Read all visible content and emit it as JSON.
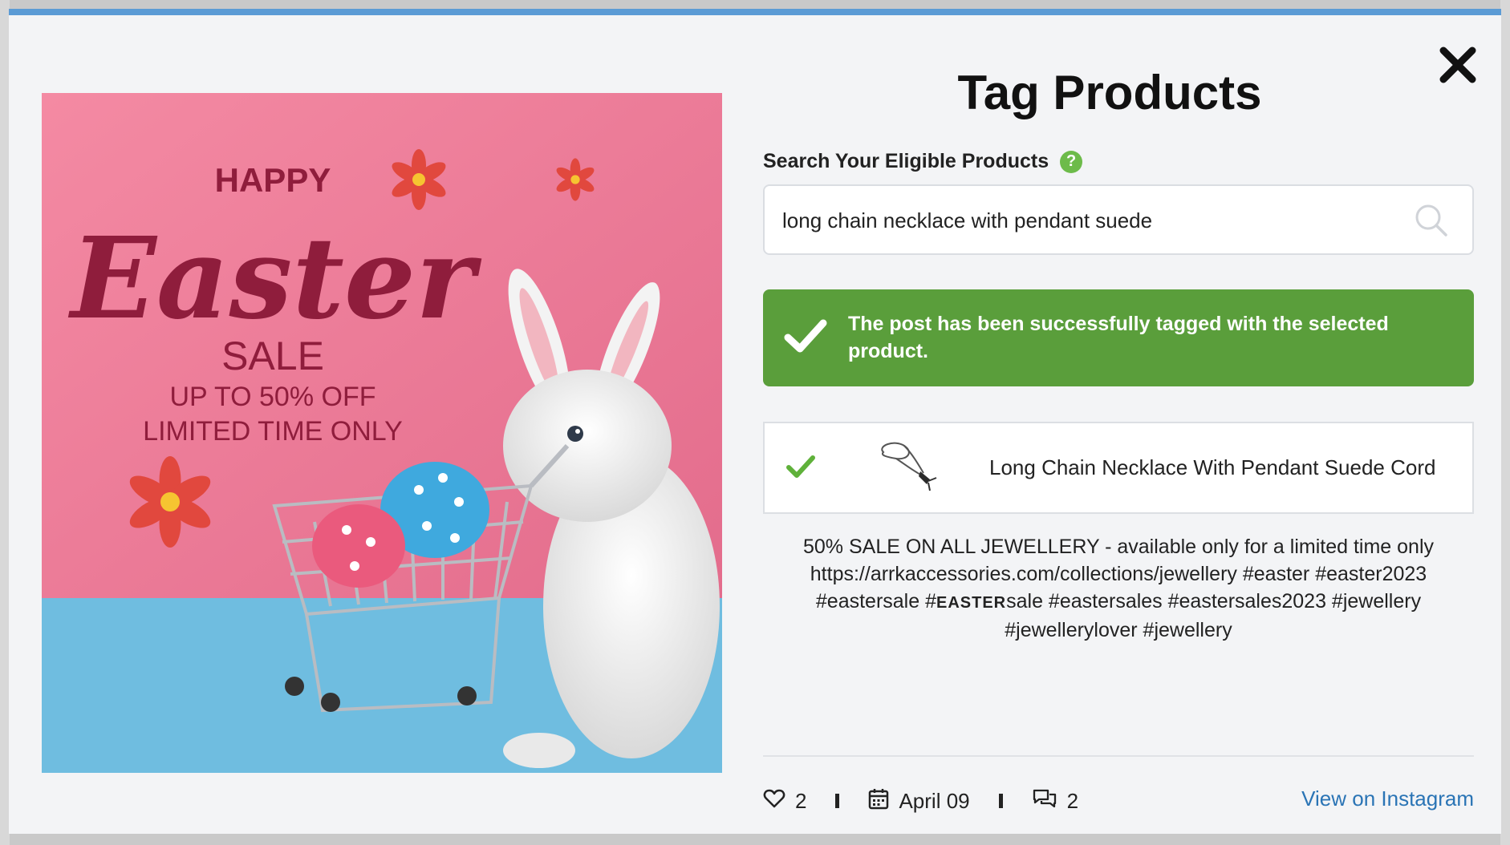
{
  "modal": {
    "title": "Tag Products",
    "close_icon": "close-icon"
  },
  "post_image": {
    "text": {
      "happy": "HAPPY",
      "easter": "Easter",
      "sale": "SALE",
      "offer": "UP TO 50% OFF",
      "limited": "LIMITED TIME ONLY"
    },
    "colors": {
      "background": "#ea7b96",
      "floor": "#6fbde0",
      "script": "#8f1d3c"
    }
  },
  "search": {
    "label": "Search Your Eligible Products",
    "help_icon": "?",
    "value": "long chain necklace with pendant suede",
    "search_icon": "search-icon"
  },
  "success_banner": {
    "message": "The post has been successfully tagged with the selected product.",
    "color": "#5a9e3b"
  },
  "tagged_product": {
    "name": "Long Chain Necklace With Pendant Suede Cord",
    "selected": true
  },
  "caption": {
    "line1": "50% SALE ON ALL JEWELLERY - available only for a limited time only",
    "line2": "https://arrkaccessories.com/collections/jewellery #easter #easter2023",
    "line3_a": "#eastersale #",
    "line3_b": "EASTER",
    "line3_c": "sale #eastersales #eastersales2023 #jewellery",
    "line4": "#jewellerylover #jewellery"
  },
  "stats": {
    "likes": "2",
    "date": "April 09",
    "comments": "2"
  },
  "link": {
    "view_on_instagram": "View on Instagram"
  }
}
